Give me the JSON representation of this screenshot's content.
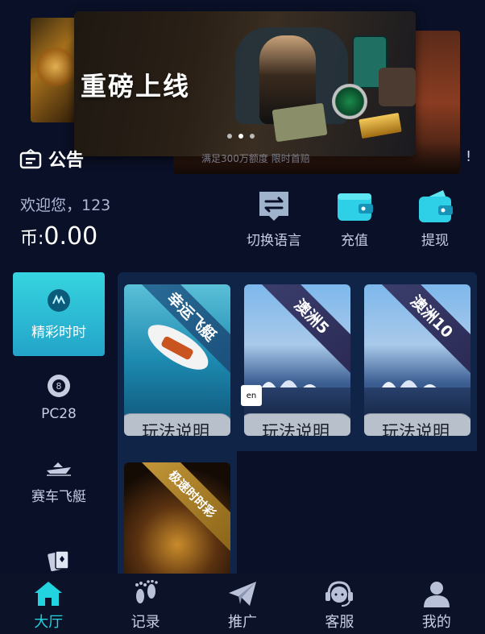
{
  "banner": {
    "headline": "重磅上线",
    "slide_count": 3,
    "active_index": 1
  },
  "notice": {
    "label": "公告",
    "text": "满足300万额度 限时首赔",
    "end_mark": "!"
  },
  "account": {
    "welcome": "欢迎您，123",
    "currency_label": "币:",
    "balance": "0.00"
  },
  "actions": [
    {
      "label": "切换语言",
      "icon": "switch-language-icon"
    },
    {
      "label": "充值",
      "icon": "wallet-icon"
    },
    {
      "label": "提现",
      "icon": "withdraw-wallet-icon"
    }
  ],
  "sidebar": {
    "items": [
      {
        "label": "精彩时时",
        "icon": "lottery-ball-icon",
        "active": true
      },
      {
        "label": "PC28",
        "icon": "billiard-8-icon",
        "active": false
      },
      {
        "label": "赛车飞艇",
        "icon": "speedboat-icon",
        "active": false
      },
      {
        "label": "",
        "icon": "cards-icon",
        "active": false
      }
    ]
  },
  "games": [
    {
      "title": "幸运飞艇",
      "rule_label": "玩法说明",
      "scene": "speedboat"
    },
    {
      "title": "澳洲5",
      "rule_label": "玩法说明",
      "scene": "sydney-opera"
    },
    {
      "title": "澳洲10",
      "rule_label": "玩法说明",
      "scene": "sydney-opera"
    },
    {
      "title": "极速时时彩",
      "rule_label": "",
      "scene": "treasure-chest"
    }
  ],
  "language_badge": "en",
  "tabbar": [
    {
      "label": "大厅",
      "icon": "home-icon",
      "active": true
    },
    {
      "label": "记录",
      "icon": "footprint-icon",
      "active": false
    },
    {
      "label": "推广",
      "icon": "paper-plane-icon",
      "active": false
    },
    {
      "label": "客服",
      "icon": "headset-icon",
      "active": false
    },
    {
      "label": "我的",
      "icon": "user-icon",
      "active": false
    }
  ],
  "colors": {
    "background": "#0a1027",
    "accent": "#22d3e0",
    "panel": "#0f2447",
    "sidebar_active": "#2bc0d8"
  }
}
